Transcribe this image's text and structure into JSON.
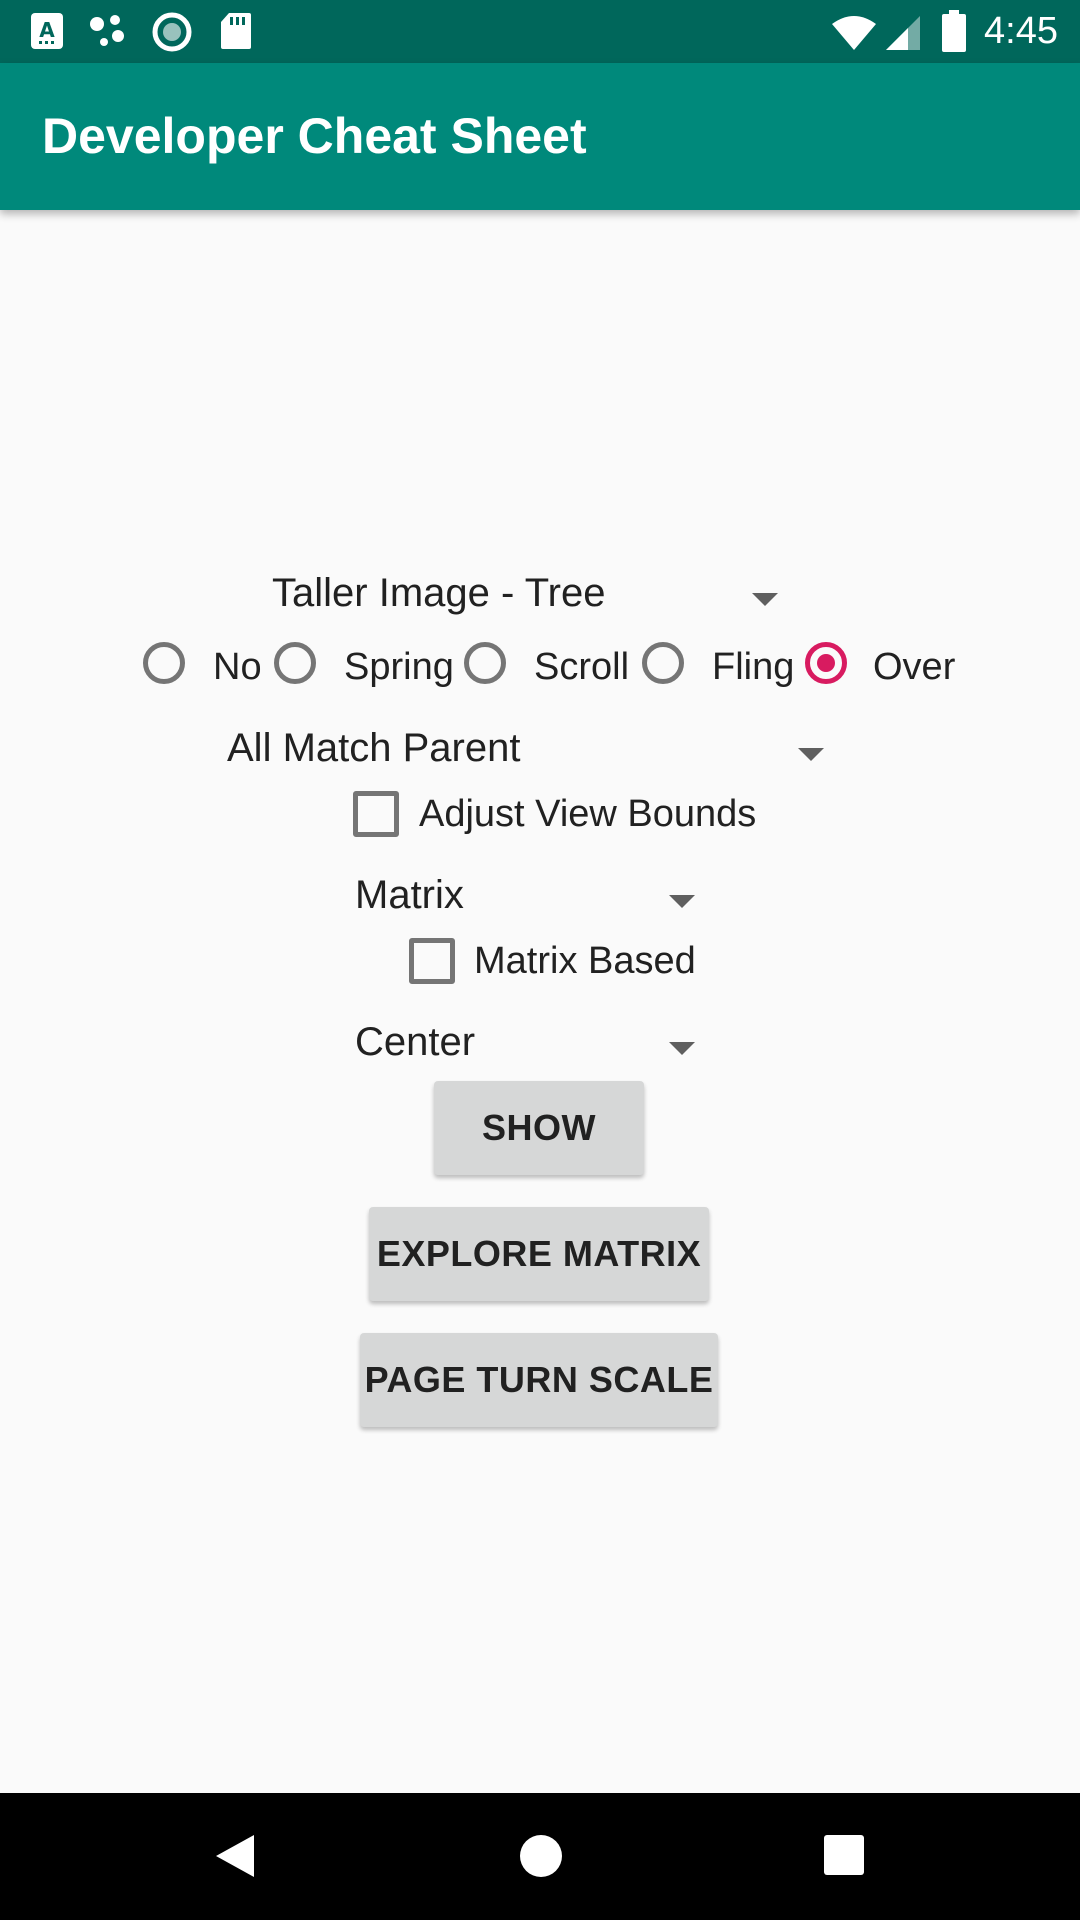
{
  "status_bar": {
    "time": "4:45",
    "left_icons": [
      "accessibility-icon",
      "assistant-icon",
      "sync-circle-icon",
      "sd-card-icon"
    ],
    "right_icons": [
      "wifi-icon",
      "signal-icon",
      "battery-icon"
    ]
  },
  "app_bar": {
    "title": "Developer Cheat Sheet"
  },
  "image_spinner": {
    "selected": "Taller Image - Tree"
  },
  "overscroll_radio": {
    "options": [
      {
        "label": "No",
        "checked": false
      },
      {
        "label": "Spring",
        "checked": false
      },
      {
        "label": "Scroll",
        "checked": false
      },
      {
        "label": "Fling",
        "checked": false
      },
      {
        "label": "Over",
        "checked": true
      }
    ]
  },
  "layout_spinner": {
    "selected": "All Match Parent"
  },
  "adjust_view_bounds": {
    "label": "Adjust View Bounds",
    "checked": false
  },
  "scale_type_spinner": {
    "selected": "Matrix"
  },
  "matrix_based": {
    "label": "Matrix Based",
    "checked": false
  },
  "gravity_spinner": {
    "selected": "Center"
  },
  "buttons": {
    "show": "SHOW",
    "explore_matrix": "EXPLORE MATRIX",
    "page_turn_scale": "PAGE TURN SCALE"
  },
  "nav_bar": {
    "icons": [
      "back-icon",
      "home-icon",
      "recents-icon"
    ]
  },
  "colors": {
    "status_bar": "#00675b",
    "app_bar": "#00897b",
    "accent": "#d81b60",
    "button": "#d6d7d7"
  }
}
